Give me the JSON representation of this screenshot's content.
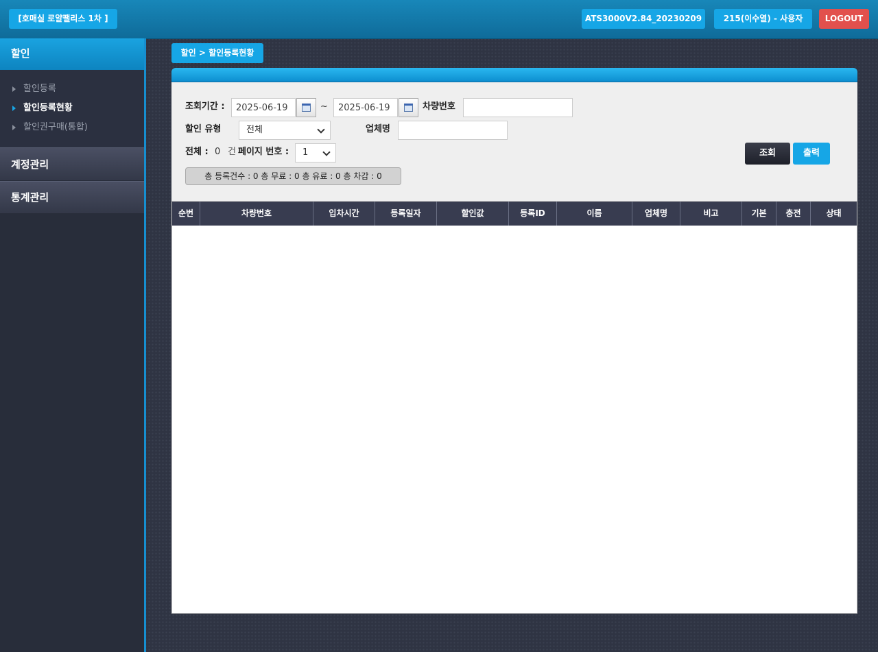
{
  "header": {
    "site_name": "[호매실 로얄팰리스 1차 ]",
    "version": "ATS3000V2.84_20230209",
    "user": "215(이수열) - 사용자",
    "logout": "LOGOUT"
  },
  "sidebar": {
    "section_title": "할인",
    "items": [
      {
        "label": "할인등록",
        "active": false
      },
      {
        "label": "할인등록현황",
        "active": true
      },
      {
        "label": "할인권구매(통합)",
        "active": false
      }
    ],
    "sections": [
      {
        "label": "계정관리"
      },
      {
        "label": "통계관리"
      }
    ]
  },
  "breadcrumb": "할인 > 할인등록현황",
  "filter": {
    "period_label": "조회기간 :",
    "date_from": "2025-06-19",
    "tilde": "~",
    "date_to": "2025-06-19",
    "plate_label": "차량번호",
    "plate_value": "",
    "type_label": "할인 유형",
    "type_value": "전체",
    "company_label": "업체명",
    "company_value": "",
    "total_label": "전체 :",
    "total_count": "0",
    "count_unit": "건",
    "page_label": "페이지 번호 :",
    "page_value": "1",
    "summary": "총 등록건수 : 0 총 무료 : 0 총 유료 : 0 총 차감 : 0",
    "search_button": "조회",
    "print_button": "출력"
  },
  "table": {
    "columns": [
      "순번",
      "차량번호",
      "입차시간",
      "등록일자",
      "할인값",
      "등록ID",
      "이름",
      "업체명",
      "비고",
      "기본",
      "충전",
      "상태"
    ],
    "rows": []
  },
  "colors": {
    "accent": "#16a6e6",
    "logout": "#e2504d",
    "header_dark": "#383c50"
  }
}
